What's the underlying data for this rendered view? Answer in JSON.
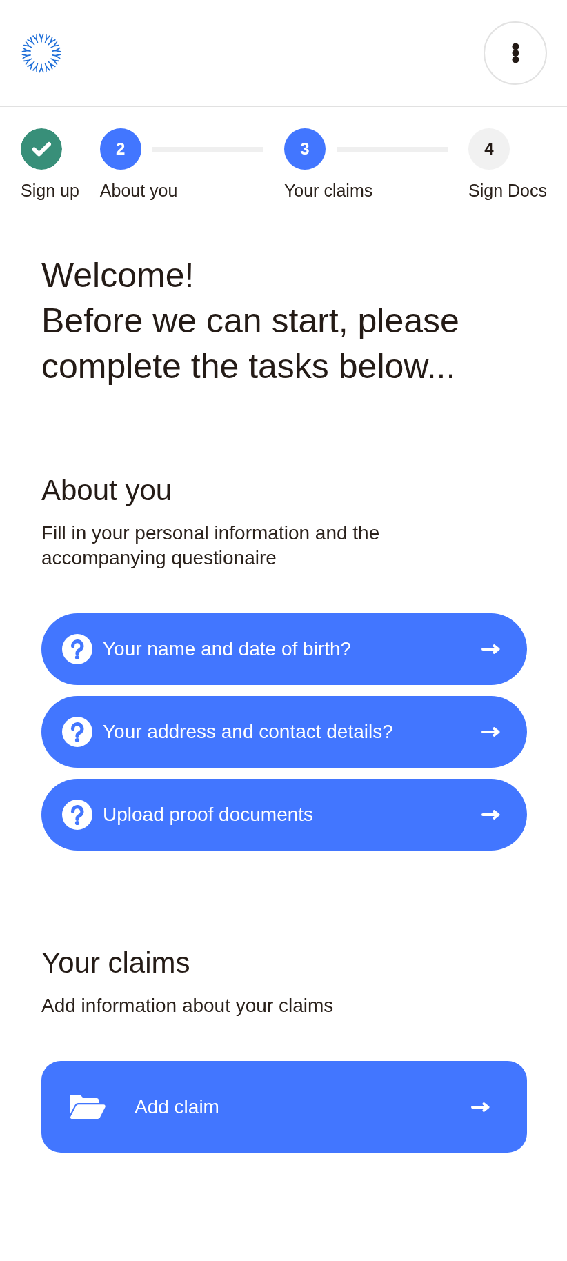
{
  "steps": [
    {
      "label": "Sign up",
      "completed": true,
      "active": false
    },
    {
      "number": "2",
      "label": "About you",
      "completed": false,
      "active": true
    },
    {
      "number": "3",
      "label": "Your claims",
      "completed": false,
      "active": true
    },
    {
      "number": "4",
      "label": "Sign Docs",
      "completed": false,
      "active": false
    }
  ],
  "welcome": {
    "title": "Welcome!",
    "text": "Before we can start, please complete the tasks below..."
  },
  "sections": [
    {
      "title": "About you",
      "description": "Fill in your personal information and the accompanying questionaire",
      "tasks": [
        {
          "kind": "question",
          "label": "Your name and date of birth?"
        },
        {
          "kind": "question",
          "label": "Your address and contact details?"
        },
        {
          "kind": "question",
          "label": "Upload proof documents"
        }
      ]
    },
    {
      "title": "Your claims",
      "description": "Add information about your claims",
      "tasks": [
        {
          "kind": "folder",
          "label": "Add claim"
        }
      ]
    }
  ]
}
